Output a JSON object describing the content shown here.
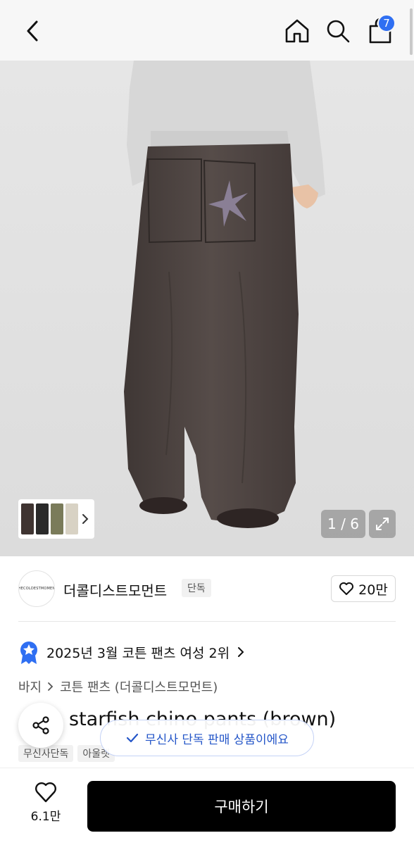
{
  "header": {
    "cart_count": "7"
  },
  "gallery": {
    "counter": "1 / 6"
  },
  "brand": {
    "logo_text": "THECOLDESTMOMENT",
    "name": "더콜디스트모먼트",
    "tag": "단독",
    "likes": "20만"
  },
  "ranking": {
    "text": "2025년 3월 코튼 팬츠 여성 2위"
  },
  "breadcrumb": {
    "category": "바지",
    "subcategory": "코튼 팬츠 (더콜디스트모먼트)"
  },
  "product": {
    "title": "starfish chino pants (brown)",
    "tags": [
      "무신사단독",
      "아울렛"
    ]
  },
  "toast": {
    "text": "무신사 단독 판매 상품이에요"
  },
  "bottom": {
    "wish_count": "6.1만",
    "buy_label": "구매하기"
  },
  "colors": {
    "accent": "#2f6ff2",
    "pants": "#4f4643",
    "sweatshirt": "#d6d6d6"
  }
}
